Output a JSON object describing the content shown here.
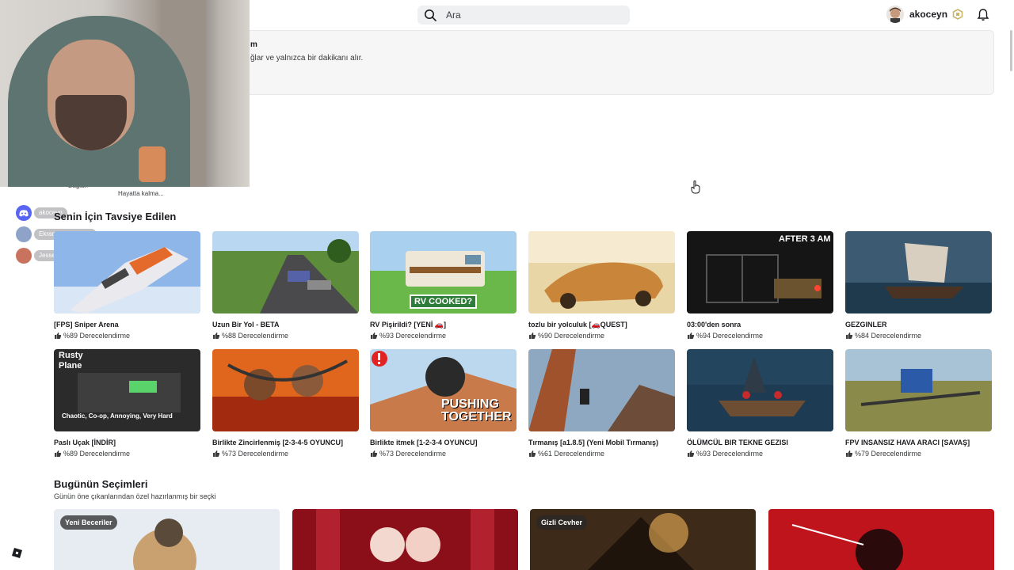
{
  "topbar": {
    "search_placeholder": "Ara",
    "username": "akoceyn"
  },
  "notice": {
    "title_fragment": "m",
    "text_fragment": "ğlar ve yalnızca bir dakikanı alır."
  },
  "cut_labels": [
    "Bağlan",
    "Hayatta kalma..."
  ],
  "overlay_list": [
    {
      "label": "akoceyn",
      "color": "#5865f2"
    },
    {
      "label": "Ekran Yayını · 5 sn",
      "color": "#8fa3c8"
    },
    {
      "label": "Jesse Pinkman",
      "color": "#c9735e"
    }
  ],
  "recommended": {
    "title": "Senin İçin Tavsiye Edilen",
    "rating_suffix": "Derecelendirme",
    "games": [
      {
        "title": "[FPS] Sniper Arena",
        "rating": "%89"
      },
      {
        "title": "Uzun Bir Yol - BETA",
        "rating": "%88"
      },
      {
        "title": "RV Pişirildi? [YENİ 🚗]",
        "rating": "%93",
        "thumb_text": "RV COOKED?"
      },
      {
        "title": "tozlu bir yolculuk [🚗QUEST]",
        "rating": "%90"
      },
      {
        "title": "03:00'den sonra",
        "rating": "%94",
        "thumb_text": "AFTER 3 AM"
      },
      {
        "title": "GEZGINLER",
        "rating": "%84"
      },
      {
        "title": "Paslı Uçak [İNDİR]",
        "rating": "%89",
        "thumb_text": "Rusty Plane",
        "thumb_sub": "Chaotic, Co-op, Annoying, Very Hard"
      },
      {
        "title": "Birlikte Zincirlenmiş [2-3-4-5 OYUNCU]",
        "rating": "%73"
      },
      {
        "title": "Birlikte itmek [1-2-3-4 OYUNCU]",
        "rating": "%73",
        "thumb_text": "PUSHING TOGETHER"
      },
      {
        "title": "Tırmanış [a1.8.5] (Yeni Mobil Tırmanış)",
        "rating": "%61"
      },
      {
        "title": "ÖLÜMCÜL BIR TEKNE GEZISI",
        "rating": "%93"
      },
      {
        "title": "FPV INSANSIZ HAVA ARACI [SAVAŞ]",
        "rating": "%79"
      }
    ]
  },
  "todays_picks": {
    "title": "Bugünün Seçimleri",
    "subtitle": "Günün öne çıkanlarından özel hazırlanmış bir seçki",
    "cards": [
      {
        "badge": "Yeni Beceriler"
      },
      {
        "badge": ""
      },
      {
        "badge": "Gizli Cevher"
      },
      {
        "badge": ""
      }
    ]
  },
  "colors": {
    "accent_blue": "#335fff",
    "text_primary": "#1b1c1f"
  }
}
